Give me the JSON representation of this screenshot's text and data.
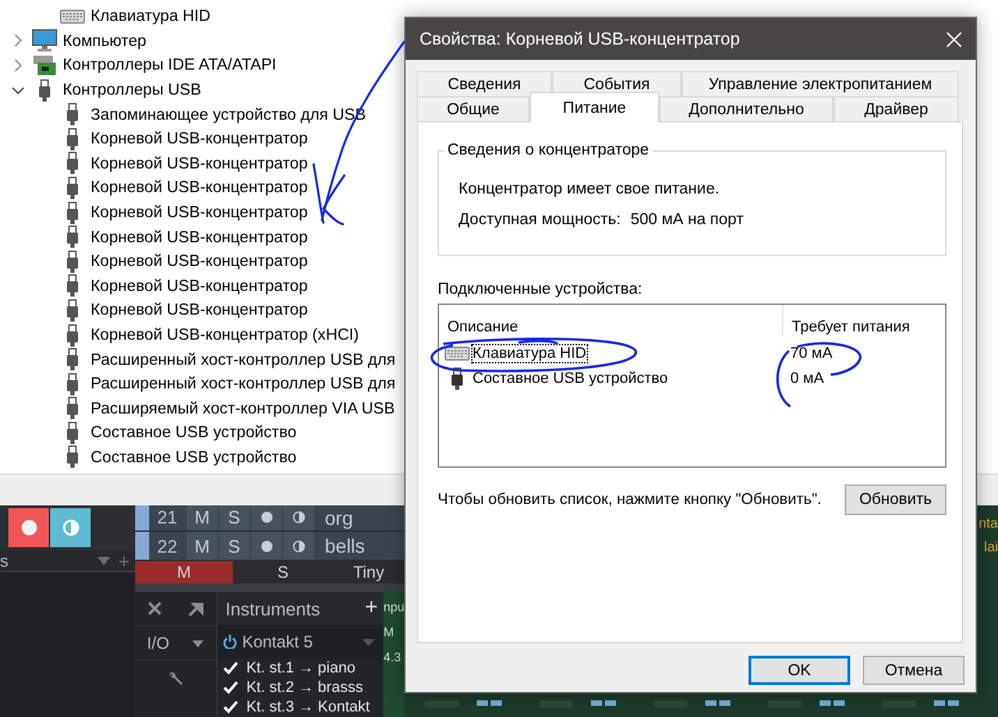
{
  "device_tree": {
    "items": [
      {
        "label": "Клавиатура HID",
        "kind": "keyboard"
      },
      {
        "label": "Компьютер",
        "kind": "computer",
        "expanded": false
      },
      {
        "label": "Контроллеры IDE ATA/ATAPI",
        "kind": "disk-controller",
        "expanded": false
      },
      {
        "label": "Контроллеры USB",
        "kind": "usb",
        "expanded": true,
        "children": [
          {
            "label": "Запоминающее устройство для USB",
            "kind": "usb"
          },
          {
            "label": "Корневой USB-концентратор",
            "kind": "usb"
          },
          {
            "label": "Корневой USB-концентратор",
            "kind": "usb"
          },
          {
            "label": "Корневой USB-концентратор",
            "kind": "usb"
          },
          {
            "label": "Корневой USB-концентратор",
            "kind": "usb"
          },
          {
            "label": "Корневой USB-концентратор",
            "kind": "usb"
          },
          {
            "label": "Корневой USB-концентратор",
            "kind": "usb"
          },
          {
            "label": "Корневой USB-концентратор",
            "kind": "usb"
          },
          {
            "label": "Корневой USB-концентратор",
            "kind": "usb"
          },
          {
            "label": "Корневой USB-концентратор (xHCI)",
            "kind": "usb"
          },
          {
            "label": "Расширенный хост-контроллер USB для",
            "kind": "usb"
          },
          {
            "label": "Расширенный хост-контроллер USB для",
            "kind": "usb"
          },
          {
            "label": "Расширяемый хост-контроллер VIA USB",
            "kind": "usb"
          },
          {
            "label": "Составное USB устройство",
            "kind": "usb"
          },
          {
            "label": "Составное USB устройство",
            "kind": "usb"
          }
        ]
      }
    ]
  },
  "dialog": {
    "title": "Свойства: Корневой USB-концентратор",
    "tab_rows": [
      [
        {
          "label": "Сведения",
          "selected": false
        },
        {
          "label": "События",
          "selected": false
        },
        {
          "label": "Управление электропитанием",
          "selected": false
        }
      ],
      [
        {
          "label": "Общие",
          "selected": false
        },
        {
          "label": "Питание",
          "selected": true
        },
        {
          "label": "Дополнительно",
          "selected": false
        },
        {
          "label": "Драйвер",
          "selected": false
        }
      ]
    ],
    "hub_info": {
      "title": "Сведения о концентраторе",
      "power_note": "Концентратор имеет свое питание.",
      "available_label": "Доступная мощность:",
      "available_value": "500 мА на порт"
    },
    "devices": {
      "label": "Подключенные устройства:",
      "columns": [
        "Описание",
        "Требует питания"
      ],
      "rows": [
        {
          "name": "Клавиатура HID",
          "kind": "keyboard",
          "power": "70 мА",
          "focused": true
        },
        {
          "name": "Составное USB устройство",
          "kind": "usb",
          "power": "0 мА",
          "focused": false
        }
      ]
    },
    "hint": "Чтобы обновить список, нажмите кнопку \"Обновить\".",
    "refresh_button": "Обновить",
    "buttons": [
      {
        "label": "OK",
        "default": true
      },
      {
        "label": "Отмена",
        "default": false
      }
    ]
  },
  "daw": {
    "left_panel": {
      "record": true,
      "monitor": true,
      "label": "s",
      "add": "+"
    },
    "tracks": [
      {
        "number": "21",
        "mute": "M",
        "solo": "S",
        "name": "org"
      },
      {
        "number": "22",
        "mute": "M",
        "solo": "S",
        "name": "bells"
      }
    ],
    "track_footer": [
      {
        "label": "M",
        "active": true
      },
      {
        "label": "S",
        "active": false
      },
      {
        "label": "Tiny",
        "active": false
      }
    ],
    "instruments": {
      "title": "Instruments",
      "add": "+",
      "io": "I/O",
      "plugin": {
        "name": "Kontakt 5",
        "on": true
      },
      "outputs": [
        {
          "label": "Kt. st.1 → piano",
          "checked": true
        },
        {
          "label": "Kt. st.2 → brasss",
          "checked": true
        },
        {
          "label": "Kt. st.3 → Kontakt",
          "checked": true
        }
      ]
    },
    "partial_labels": [
      "npu",
      "M",
      "4.3"
    ],
    "edge_labels": [
      "nta",
      "lai"
    ]
  }
}
